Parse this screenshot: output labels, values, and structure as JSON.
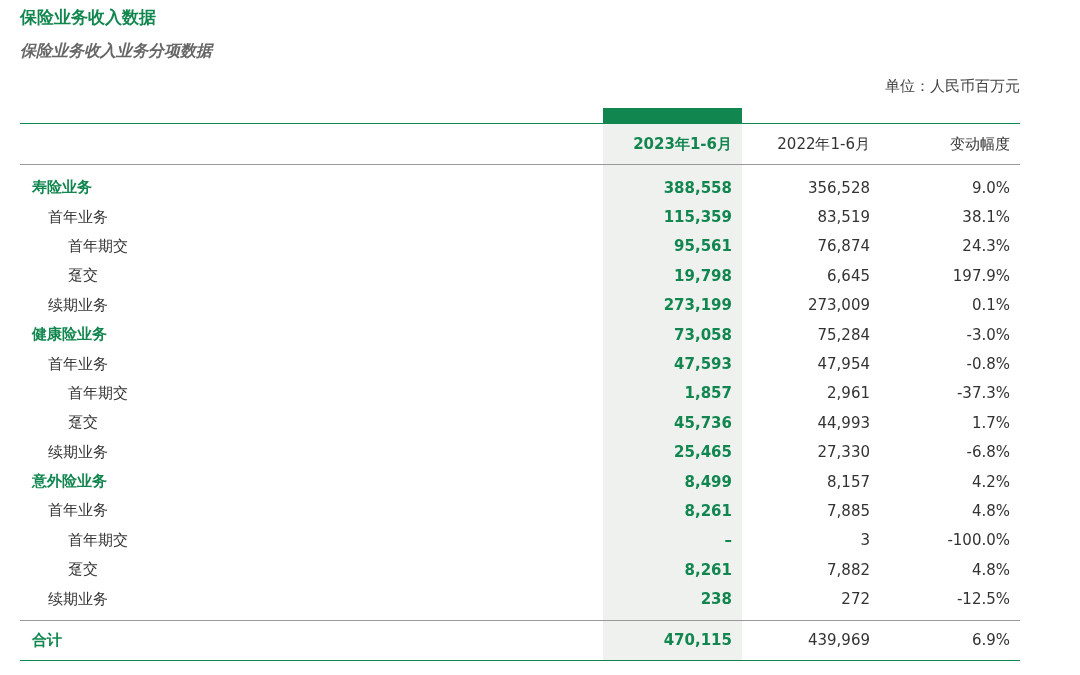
{
  "title": "保险业务收入数据",
  "subtitle": "保险业务收入业务分项数据",
  "unit": "单位：人民币百万元",
  "table": {
    "columns": [
      {
        "label": "2023年1-6月",
        "highlighted": true
      },
      {
        "label": "2022年1-6月",
        "highlighted": false
      },
      {
        "label": "变动幅度",
        "highlighted": false
      }
    ],
    "rows": [
      {
        "label": "寿险业务",
        "cells": [
          "388,558",
          "356,528",
          "9.0%"
        ],
        "children": [
          {
            "label": "首年业务",
            "cells": [
              "115,359",
              "83,519",
              "38.1%"
            ],
            "children": [
              {
                "label": "首年期交",
                "cells": [
                  "95,561",
                  "76,874",
                  "24.3%"
                ]
              },
              {
                "label": "趸交",
                "cells": [
                  "19,798",
                  "6,645",
                  "197.9%"
                ]
              }
            ]
          },
          {
            "label": "续期业务",
            "cells": [
              "273,199",
              "273,009",
              "0.1%"
            ]
          }
        ]
      },
      {
        "label": "健康险业务",
        "cells": [
          "73,058",
          "75,284",
          "-3.0%"
        ],
        "children": [
          {
            "label": "首年业务",
            "cells": [
              "47,593",
              "47,954",
              "-0.8%"
            ],
            "children": [
              {
                "label": "首年期交",
                "cells": [
                  "1,857",
                  "2,961",
                  "-37.3%"
                ]
              },
              {
                "label": "趸交",
                "cells": [
                  "45,736",
                  "44,993",
                  "1.7%"
                ]
              }
            ]
          },
          {
            "label": "续期业务",
            "cells": [
              "25,465",
              "27,330",
              "-6.8%"
            ]
          }
        ]
      },
      {
        "label": "意外险业务",
        "cells": [
          "8,499",
          "8,157",
          "4.2%"
        ],
        "children": [
          {
            "label": "首年业务",
            "cells": [
              "8,261",
              "7,885",
              "4.8%"
            ],
            "children": [
              {
                "label": "首年期交",
                "cells": [
                  "–",
                  "3",
                  "-100.0%"
                ]
              },
              {
                "label": "趸交",
                "cells": [
                  "8,261",
                  "7,882",
                  "4.8%"
                ]
              }
            ]
          },
          {
            "label": "续期业务",
            "cells": [
              "238",
              "272",
              "-12.5%"
            ]
          }
        ]
      }
    ],
    "total": {
      "label": "合计",
      "cells": [
        "470,115",
        "439,969",
        "6.9%"
      ]
    }
  }
}
